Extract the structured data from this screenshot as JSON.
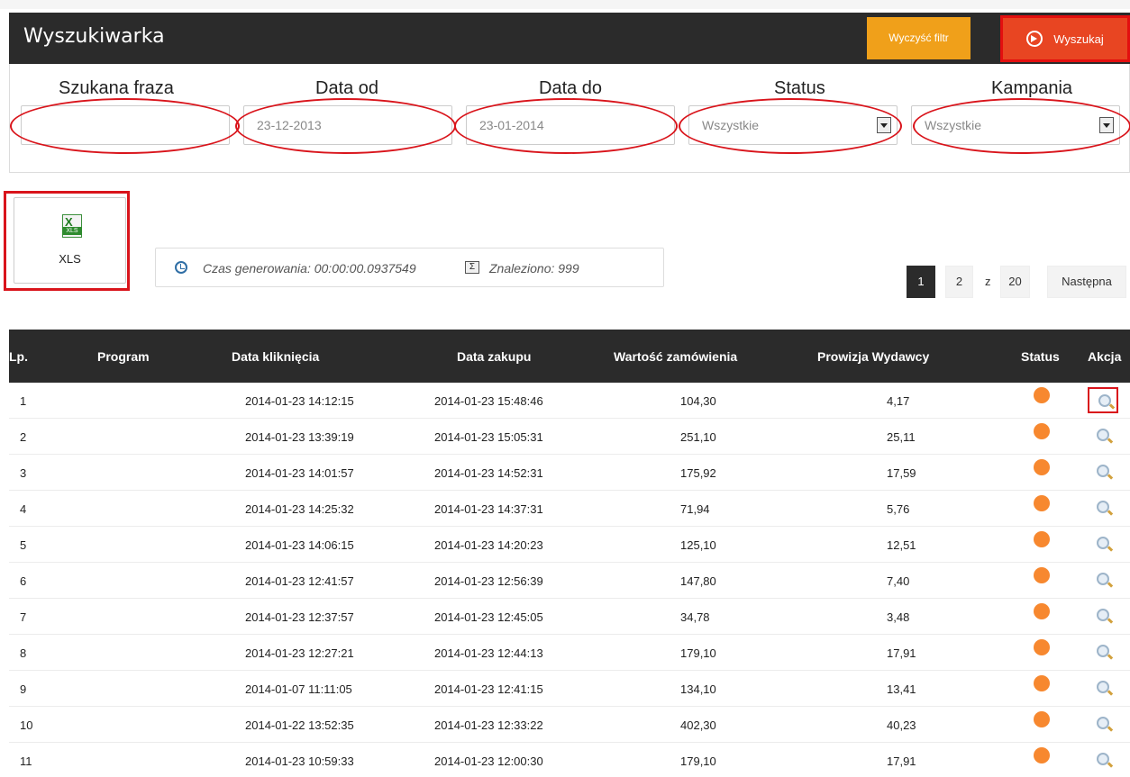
{
  "header": {
    "title": "Wyszukiwarka",
    "clear_label": "Wyczyść filtr",
    "search_label": "Wyszukaj"
  },
  "filters": {
    "phrase": {
      "label": "Szukana fraza",
      "value": ""
    },
    "date_from": {
      "label": "Data od",
      "value": "23-12-2013"
    },
    "date_to": {
      "label": "Data do",
      "value": "23-01-2014"
    },
    "status": {
      "label": "Status",
      "value": "Wszystkie"
    },
    "campaign": {
      "label": "Kampania",
      "value": "Wszystkie"
    }
  },
  "export": {
    "label": "XLS",
    "icon": "excel-file-icon"
  },
  "info": {
    "time_text": "Czas generowania: 00:00:00.0937549",
    "found_text": "Znaleziono: 999",
    "icons": [
      "clock-icon",
      "sigma-icon"
    ]
  },
  "pagination": {
    "current": "1",
    "next_page": "2",
    "of_label": "z",
    "total": "20",
    "next_label": "Następna"
  },
  "table": {
    "headers": [
      "Lp.",
      "Program",
      "Data kliknięcia",
      "Data zakupu",
      "Wartość zamówienia",
      "Prowizja Wydawcy",
      "Status",
      "Akcja"
    ],
    "status_color": "#f7882f",
    "rows": [
      {
        "lp": "1",
        "program": "",
        "click": "2014-01-23 14:12:15",
        "purchase": "2014-01-23 15:48:46",
        "value": "104,30",
        "commission": "4,17"
      },
      {
        "lp": "2",
        "program": "",
        "click": "2014-01-23 13:39:19",
        "purchase": "2014-01-23 15:05:31",
        "value": "251,10",
        "commission": "25,11"
      },
      {
        "lp": "3",
        "program": "",
        "click": "2014-01-23 14:01:57",
        "purchase": "2014-01-23 14:52:31",
        "value": "175,92",
        "commission": "17,59"
      },
      {
        "lp": "4",
        "program": "",
        "click": "2014-01-23 14:25:32",
        "purchase": "2014-01-23 14:37:31",
        "value": "71,94",
        "commission": "5,76"
      },
      {
        "lp": "5",
        "program": "",
        "click": "2014-01-23 14:06:15",
        "purchase": "2014-01-23 14:20:23",
        "value": "125,10",
        "commission": "12,51"
      },
      {
        "lp": "6",
        "program": "",
        "click": "2014-01-23 12:41:57",
        "purchase": "2014-01-23 12:56:39",
        "value": "147,80",
        "commission": "7,40"
      },
      {
        "lp": "7",
        "program": "",
        "click": "2014-01-23 12:37:57",
        "purchase": "2014-01-23 12:45:05",
        "value": "34,78",
        "commission": "3,48"
      },
      {
        "lp": "8",
        "program": "",
        "click": "2014-01-23 12:27:21",
        "purchase": "2014-01-23 12:44:13",
        "value": "179,10",
        "commission": "17,91"
      },
      {
        "lp": "9",
        "program": "",
        "click": "2014-01-07 11:11:05",
        "purchase": "2014-01-23 12:41:15",
        "value": "134,10",
        "commission": "13,41"
      },
      {
        "lp": "10",
        "program": "",
        "click": "2014-01-22 13:52:35",
        "purchase": "2014-01-23 12:33:22",
        "value": "402,30",
        "commission": "40,23"
      },
      {
        "lp": "11",
        "program": "",
        "click": "2014-01-23 10:59:33",
        "purchase": "2014-01-23 12:00:30",
        "value": "179,10",
        "commission": "17,91"
      }
    ]
  }
}
